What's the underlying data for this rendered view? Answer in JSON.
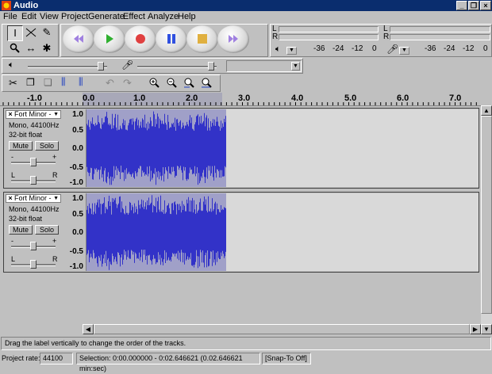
{
  "window": {
    "title": "Audio"
  },
  "menu": [
    "File",
    "Edit",
    "View",
    "Project",
    "Generate",
    "Effect",
    "Analyze",
    "Help"
  ],
  "meters": {
    "left_letter": "L",
    "right_letter": "R",
    "ticks": [
      "-36",
      "-24",
      "-12",
      "0"
    ]
  },
  "ruler": {
    "labels": [
      "-1.0",
      "0.0",
      "1.0",
      "2.0",
      "3.0",
      "4.0",
      "5.0",
      "6.0",
      "7.0"
    ]
  },
  "tracks": [
    {
      "name": "Fort Minor -",
      "info_line1": "Mono, 44100Hz",
      "info_line2": "32-bit float",
      "mute": "Mute",
      "solo": "Solo",
      "gain_minus": "-",
      "gain_plus": "+",
      "pan_left": "L",
      "pan_right": "R",
      "scale": [
        "1.0",
        "0.5",
        "0.0",
        "-0.5",
        "-1.0"
      ]
    },
    {
      "name": "Fort Minor -",
      "info_line1": "Mono, 44100Hz",
      "info_line2": "32-bit float",
      "mute": "Mute",
      "solo": "Solo",
      "gain_minus": "-",
      "gain_plus": "+",
      "pan_left": "L",
      "pan_right": "R",
      "scale": [
        "1.0",
        "0.5",
        "0.0",
        "-0.5",
        "-1.0"
      ]
    }
  ],
  "status": {
    "hint": "Drag the label vertically to change the order of the tracks.",
    "project_rate_label": "Project rate:",
    "project_rate_value": "44100",
    "selection": "Selection: 0:00.000000 - 0:02.646621 (0.02.646621 min:sec)",
    "snap": "[Snap-To Off]"
  },
  "colors": {
    "title_bg": "#0a2d6e",
    "wave": "#3232c8",
    "selection": "#a0a0c8"
  }
}
